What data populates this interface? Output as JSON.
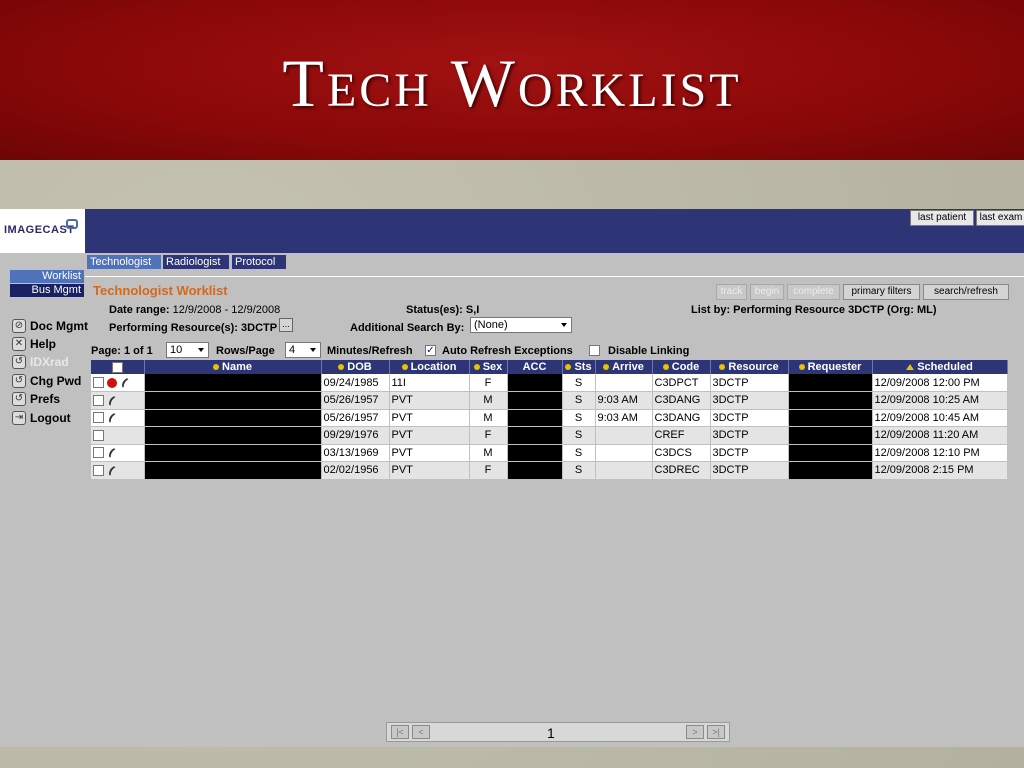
{
  "slide": {
    "title": "Tech Worklist"
  },
  "app": {
    "logo": "IMAGECAST",
    "header_buttons": {
      "last_patient": "last patient",
      "last_exam": "last exam"
    },
    "tabs": [
      {
        "label": "Technologist",
        "active": true
      },
      {
        "label": "Radiologist",
        "active": false
      },
      {
        "label": "Protocol",
        "active": false
      }
    ],
    "sidebar": {
      "worklist": "Worklist",
      "bus_mgmt": "Bus Mgmt",
      "items": [
        {
          "label": "Doc Mgmt",
          "icon": "doc-icon"
        },
        {
          "label": "Help",
          "icon": "help-icon"
        },
        {
          "label": "IDXrad",
          "icon": "idxrad-icon"
        },
        {
          "label": "Chg Pwd",
          "icon": "key-icon"
        },
        {
          "label": "Prefs",
          "icon": "prefs-icon"
        },
        {
          "label": "Logout",
          "icon": "logout-icon"
        }
      ]
    },
    "worklist": {
      "title": "Technologist Worklist",
      "actions": {
        "track": "track",
        "begin": "begin",
        "complete": "complete",
        "primary_filters": "primary filters",
        "search_refresh": "search/refresh"
      },
      "date_range_label": "Date range:",
      "date_range": "12/9/2008 - 12/9/2008",
      "statuses_label": "Status(es):",
      "statuses": "S,I",
      "list_by": "List by: Performing Resource 3DCTP  (Org: ML)",
      "perf_resource_label": "Performing Resource(s):",
      "perf_resource": "3DCTP",
      "perf_btn": "...",
      "additional_search_label": "Additional Search By:",
      "additional_search_value": "(None)",
      "page_label": "Page: 1 of 1",
      "rows_per_page_value": "10",
      "rows_per_page_label": "Rows/Page",
      "minutes_value": "4",
      "minutes_label": "Minutes/Refresh",
      "auto_refresh_label": "Auto Refresh Exceptions",
      "auto_refresh_checked": "✓",
      "disable_linking_label": "Disable Linking",
      "columns": {
        "name": "Name",
        "dob": "DOB",
        "location": "Location",
        "sex": "Sex",
        "acc": "ACC",
        "sts": "Sts",
        "arrive": "Arrive",
        "code": "Code",
        "resource": "Resource",
        "requester": "Requester",
        "scheduled": "Scheduled"
      },
      "rows": [
        {
          "dob": "09/24/1985",
          "location": "11I",
          "sex": "F",
          "sts": "S",
          "arrive": "",
          "code": "C3DPCT",
          "resource": "3DCTP",
          "scheduled": "12/09/2008 12:00 PM"
        },
        {
          "dob": "05/26/1957",
          "location": "PVT",
          "sex": "M",
          "sts": "S",
          "arrive": "9:03 AM",
          "code": "C3DANG",
          "resource": "3DCTP",
          "scheduled": "12/09/2008 10:25 AM"
        },
        {
          "dob": "05/26/1957",
          "location": "PVT",
          "sex": "M",
          "sts": "S",
          "arrive": "9:03 AM",
          "code": "C3DANG",
          "resource": "3DCTP",
          "scheduled": "12/09/2008 10:45 AM"
        },
        {
          "dob": "09/29/1976",
          "location": "PVT",
          "sex": "F",
          "sts": "S",
          "arrive": "",
          "code": "CREF",
          "resource": "3DCTP",
          "scheduled": "12/09/2008 11:20 AM"
        },
        {
          "dob": "03/13/1969",
          "location": "PVT",
          "sex": "M",
          "sts": "S",
          "arrive": "",
          "code": "C3DCS",
          "resource": "3DCTP",
          "scheduled": "12/09/2008 12:10 PM"
        },
        {
          "dob": "02/02/1956",
          "location": "PVT",
          "sex": "F",
          "sts": "S",
          "arrive": "",
          "code": "C3DREC",
          "resource": "3DCTP",
          "scheduled": "12/09/2008 2:15 PM"
        }
      ],
      "pager": {
        "first": "|<",
        "prev": "<",
        "page": "1",
        "next": ">",
        "last": ">|"
      }
    }
  }
}
